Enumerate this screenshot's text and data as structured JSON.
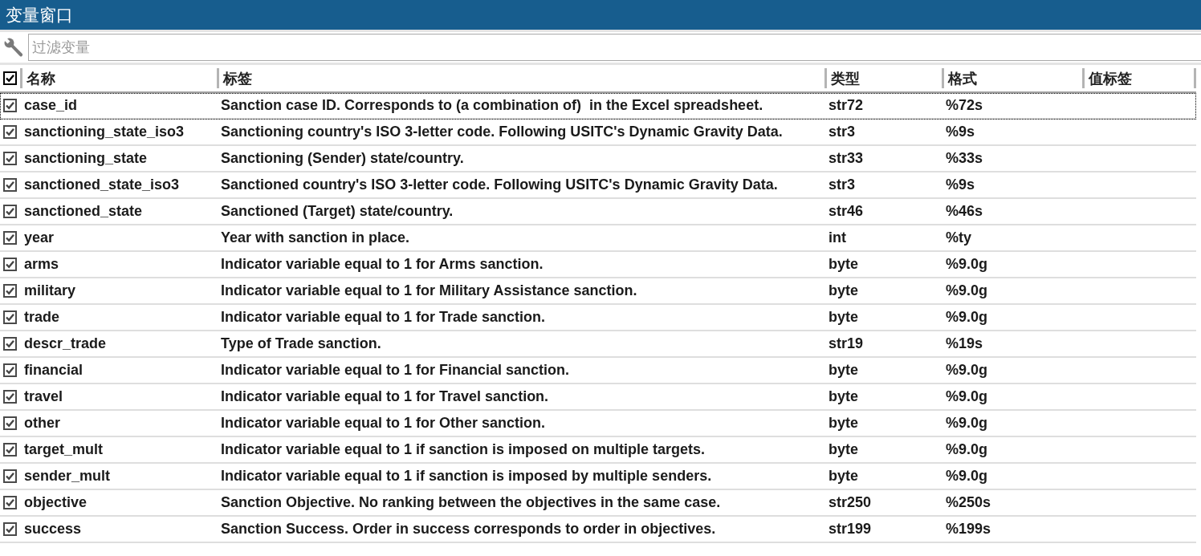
{
  "window": {
    "title": "变量窗口"
  },
  "filter": {
    "placeholder": "过滤变量"
  },
  "table": {
    "select_all": {
      "checked": true
    },
    "columns": [
      "名称",
      "标签",
      "类型",
      "格式",
      "值标签"
    ],
    "rows": [
      {
        "name": "case_id",
        "label": "Sanction case ID. Corresponds to (a combination of)  in the Excel spreadsheet.",
        "type": "str72",
        "format": "%72s",
        "checked": true,
        "selected": true
      },
      {
        "name": "sanctioning_state_iso3",
        "label": "Sanctioning country's ISO 3-letter code. Following USITC's Dynamic Gravity Data.",
        "type": "str3",
        "format": "%9s",
        "checked": true,
        "selected": false
      },
      {
        "name": "sanctioning_state",
        "label": "Sanctioning (Sender) state/country.",
        "type": "str33",
        "format": "%33s",
        "checked": true,
        "selected": false
      },
      {
        "name": "sanctioned_state_iso3",
        "label": "Sanctioned country's ISO 3-letter code. Following USITC's Dynamic Gravity Data.",
        "type": "str3",
        "format": "%9s",
        "checked": true,
        "selected": false
      },
      {
        "name": "sanctioned_state",
        "label": "Sanctioned (Target) state/country.",
        "type": "str46",
        "format": "%46s",
        "checked": true,
        "selected": false
      },
      {
        "name": "year",
        "label": "Year with sanction in place.",
        "type": "int",
        "format": "%ty",
        "checked": true,
        "selected": false
      },
      {
        "name": "arms",
        "label": "Indicator variable equal to 1 for Arms sanction.",
        "type": "byte",
        "format": "%9.0g",
        "checked": true,
        "selected": false
      },
      {
        "name": "military",
        "label": "Indicator variable equal to 1 for Military Assistance sanction.",
        "type": "byte",
        "format": "%9.0g",
        "checked": true,
        "selected": false
      },
      {
        "name": "trade",
        "label": "Indicator variable equal to 1 for Trade sanction.",
        "type": "byte",
        "format": "%9.0g",
        "checked": true,
        "selected": false
      },
      {
        "name": "descr_trade",
        "label": "Type of Trade sanction.",
        "type": "str19",
        "format": "%19s",
        "checked": true,
        "selected": false
      },
      {
        "name": "financial",
        "label": "Indicator variable equal to 1 for Financial sanction.",
        "type": "byte",
        "format": "%9.0g",
        "checked": true,
        "selected": false
      },
      {
        "name": "travel",
        "label": "Indicator variable equal to 1 for Travel sanction.",
        "type": "byte",
        "format": "%9.0g",
        "checked": true,
        "selected": false
      },
      {
        "name": "other",
        "label": "Indicator variable equal to 1 for Other sanction.",
        "type": "byte",
        "format": "%9.0g",
        "checked": true,
        "selected": false
      },
      {
        "name": "target_mult",
        "label": "Indicator variable equal to 1 if sanction is imposed on multiple targets.",
        "type": "byte",
        "format": "%9.0g",
        "checked": true,
        "selected": false
      },
      {
        "name": "sender_mult",
        "label": "Indicator variable equal to 1 if sanction is imposed by multiple senders.",
        "type": "byte",
        "format": "%9.0g",
        "checked": true,
        "selected": false
      },
      {
        "name": "objective",
        "label": "Sanction Objective. No ranking between the objectives in the same case.",
        "type": "str250",
        "format": "%250s",
        "checked": true,
        "selected": false
      },
      {
        "name": "success",
        "label": "Sanction Success. Order in success corresponds to order in objectives.",
        "type": "str199",
        "format": "%199s",
        "checked": true,
        "selected": false
      }
    ]
  }
}
